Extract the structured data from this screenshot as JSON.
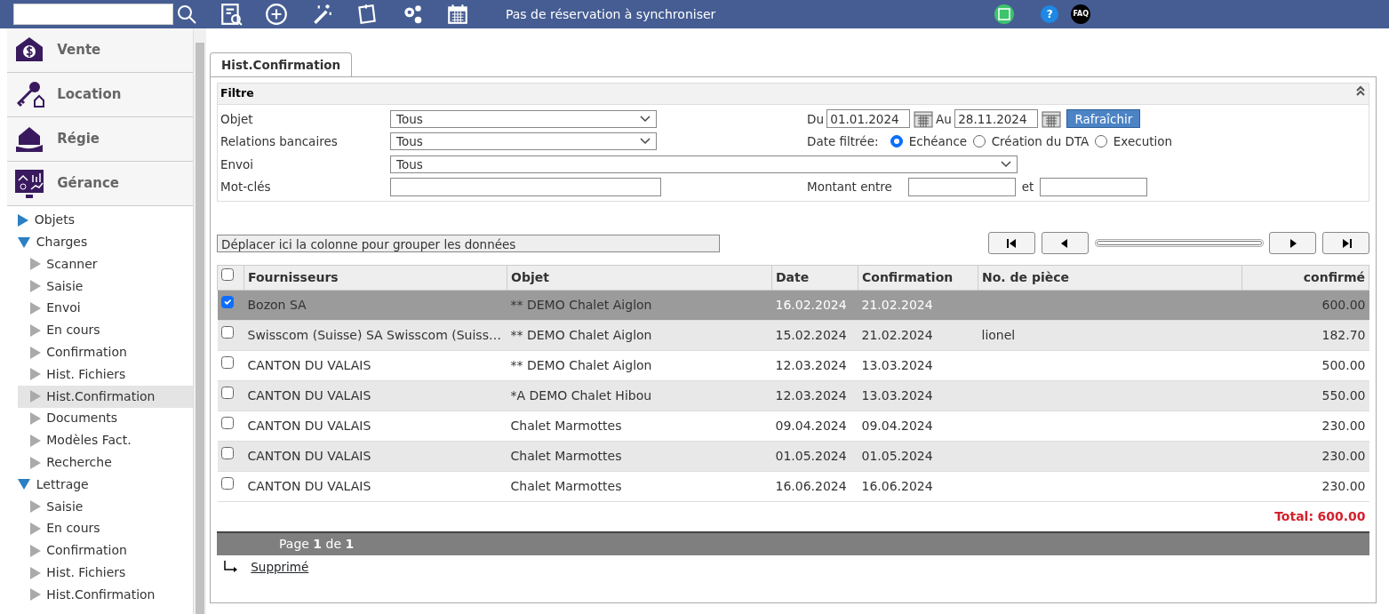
{
  "topbar": {
    "status": "Pas de réservation à synchroniser",
    "help": "?",
    "faq": "FAQ"
  },
  "sidebar": {
    "modules": [
      {
        "label": "Vente",
        "kind": "sale"
      },
      {
        "label": "Location",
        "kind": "keys"
      },
      {
        "label": "Régie",
        "kind": "house"
      },
      {
        "label": "Gérance",
        "kind": "dashboard"
      }
    ],
    "tree": [
      {
        "label": "Objets",
        "expanded": false
      },
      {
        "label": "Charges",
        "expanded": true,
        "children": [
          {
            "label": "Scanner",
            "selected": false
          },
          {
            "label": "Saisie",
            "selected": false
          },
          {
            "label": "Envoi",
            "selected": false
          },
          {
            "label": "En cours",
            "selected": false
          },
          {
            "label": "Confirmation",
            "selected": false
          },
          {
            "label": "Hist. Fichiers",
            "selected": false
          },
          {
            "label": "Hist.Confirmation",
            "selected": true
          },
          {
            "label": "Documents",
            "selected": false
          },
          {
            "label": "Modèles Fact.",
            "selected": false
          },
          {
            "label": "Recherche",
            "selected": false
          }
        ]
      },
      {
        "label": "Lettrage",
        "expanded": true,
        "children": [
          {
            "label": "Saisie",
            "selected": false
          },
          {
            "label": "En cours",
            "selected": false
          },
          {
            "label": "Confirmation",
            "selected": false
          },
          {
            "label": "Hist. Fichiers",
            "selected": false
          },
          {
            "label": "Hist.Confirmation",
            "selected": false
          }
        ]
      }
    ]
  },
  "tabs": [
    {
      "label": "Hist.Confirmation",
      "selected": true
    }
  ],
  "filter": {
    "title": "Filtre",
    "left": [
      {
        "label": "Objet",
        "kind": "select",
        "value": "Tous"
      },
      {
        "label": "Relations bancaires",
        "kind": "select",
        "value": "Tous"
      },
      {
        "label": "Envoi",
        "kind": "wide-select",
        "value": "Tous"
      },
      {
        "label": "Mot-clés",
        "kind": "text"
      }
    ],
    "from_label": "Du",
    "from": "01.01.2024",
    "to_label": "Au",
    "to": "28.11.2024",
    "refresh": "Rafraîchir",
    "date_label": "Date filtrée:",
    "date_options": [
      {
        "label": "Echéance",
        "selected": true
      },
      {
        "label": "Création du DTA",
        "selected": false
      },
      {
        "label": "Execution",
        "selected": false
      }
    ],
    "amount_label": "Montant entre",
    "amount_and": "et"
  },
  "page_slider": {
    "level": 1
  },
  "group_bar": "Déplacer ici la colonne pour grouper les données",
  "table": {
    "header_checked": false,
    "columns": [
      "Fournisseurs",
      "Objet",
      "Date",
      "Confirmation",
      "No. de pièce",
      "confirmé"
    ],
    "rows": [
      {
        "checked": true,
        "selected": true,
        "cells": [
          "Bozon SA",
          "** DEMO Chalet Aiglon",
          "16.02.2024",
          "21.02.2024",
          "",
          "600.00"
        ]
      },
      {
        "checked": false,
        "selected": false,
        "cells": [
          "Swisscom (Suisse) SA Swisscom (Suiss…",
          "** DEMO Chalet Aiglon",
          "15.02.2024",
          "21.02.2024",
          "lionel",
          "182.70"
        ]
      },
      {
        "checked": false,
        "selected": false,
        "cells": [
          "CANTON DU VALAIS",
          "** DEMO Chalet Aiglon",
          "12.03.2024",
          "13.03.2024",
          "",
          "500.00"
        ]
      },
      {
        "checked": false,
        "selected": false,
        "cells": [
          "CANTON DU VALAIS",
          "*A DEMO Chalet Hibou",
          "12.03.2024",
          "13.03.2024",
          "",
          "550.00"
        ]
      },
      {
        "checked": false,
        "selected": false,
        "cells": [
          "CANTON DU VALAIS",
          "Chalet Marmottes",
          "09.04.2024",
          "09.04.2024",
          "",
          "230.00"
        ]
      },
      {
        "checked": false,
        "selected": false,
        "cells": [
          "CANTON DU VALAIS",
          "Chalet Marmottes",
          "01.05.2024",
          "01.05.2024",
          "",
          "230.00"
        ]
      },
      {
        "checked": false,
        "selected": false,
        "cells": [
          "CANTON DU VALAIS",
          "Chalet Marmottes",
          "16.06.2024",
          "16.06.2024",
          "",
          "230.00"
        ]
      }
    ],
    "total_label": "Total:",
    "total": "600.00"
  },
  "pager": "Page **1** de **1**",
  "deleted_link": "Supprimé"
}
